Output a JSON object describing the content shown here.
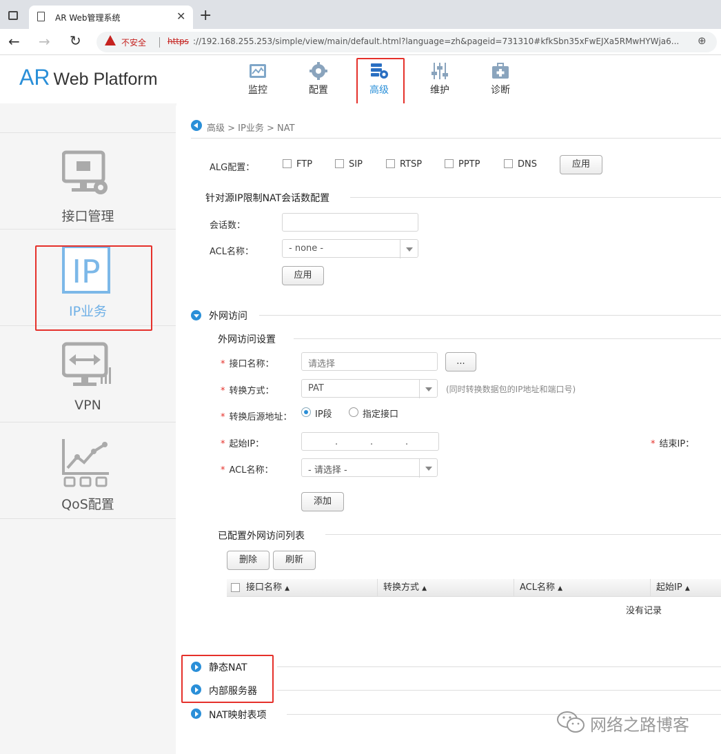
{
  "browser": {
    "tab_title": "AR Web管理系统",
    "insecure_label": "不安全",
    "url_scheme": "https",
    "url_rest": "://192.168.255.253/simple/view/main/default.html?language=zh&pageid=731310#kfkSbn35xFwEJXa5RMwHYWja6..."
  },
  "app": {
    "logo_ar": "AR",
    "logo_rest": "Web Platform",
    "nav": [
      {
        "label": "监控",
        "icon": "monitor-icon"
      },
      {
        "label": "配置",
        "icon": "gear-icon"
      },
      {
        "label": "高级",
        "icon": "advanced-icon",
        "active": true
      },
      {
        "label": "维护",
        "icon": "sliders-icon"
      },
      {
        "label": "诊断",
        "icon": "medkit-icon"
      }
    ],
    "accent": "#2a8fd8",
    "highlight_box": "#e5302a"
  },
  "sidebar": {
    "items": [
      {
        "label": "接口管理",
        "icon": "interface-icon"
      },
      {
        "label": "IP业务",
        "icon": "ip-icon",
        "active": true
      },
      {
        "label": "VPN",
        "icon": "vpn-icon"
      },
      {
        "label": "QoS配置",
        "icon": "qos-chart-icon"
      }
    ]
  },
  "breadcrumb": "高级 > IP业务 > NAT",
  "alg": {
    "label": "ALG配置：",
    "options": [
      "FTP",
      "SIP",
      "RTSP",
      "PPTP",
      "DNS"
    ],
    "apply": "应用"
  },
  "session_limit": {
    "title": "针对源IP限制NAT会话数配置",
    "sessions_label": "会话数：",
    "sessions_value": "",
    "acl_label": "ACL名称：",
    "acl_value": "- none -",
    "apply": "应用"
  },
  "wan": {
    "title": "外网访问",
    "settings_title": "外网访问设置",
    "iface_label": "接口名称：",
    "iface_placeholder": "请选择",
    "iface_browse": "...",
    "mode_label": "转换方式：",
    "mode_value": "PAT",
    "mode_hint": "(同时转换数据包的IP地址和端口号)",
    "src_label": "转换后源地址：",
    "src_options": [
      "IP段",
      "指定接口"
    ],
    "start_ip_label": "起始IP：",
    "end_ip_label": "结束IP：",
    "acl_label": "ACL名称：",
    "acl_value": "- 请选择 -",
    "add": "添加",
    "list_title": "已配置外网访问列表",
    "delete": "删除",
    "refresh": "刷新",
    "columns": [
      "接口名称",
      "转换方式",
      "ACL名称",
      "起始IP"
    ],
    "empty": "没有记录"
  },
  "sections": [
    "静态NAT",
    "内部服务器",
    "NAT映射表项"
  ],
  "watermark": "网络之路博客"
}
